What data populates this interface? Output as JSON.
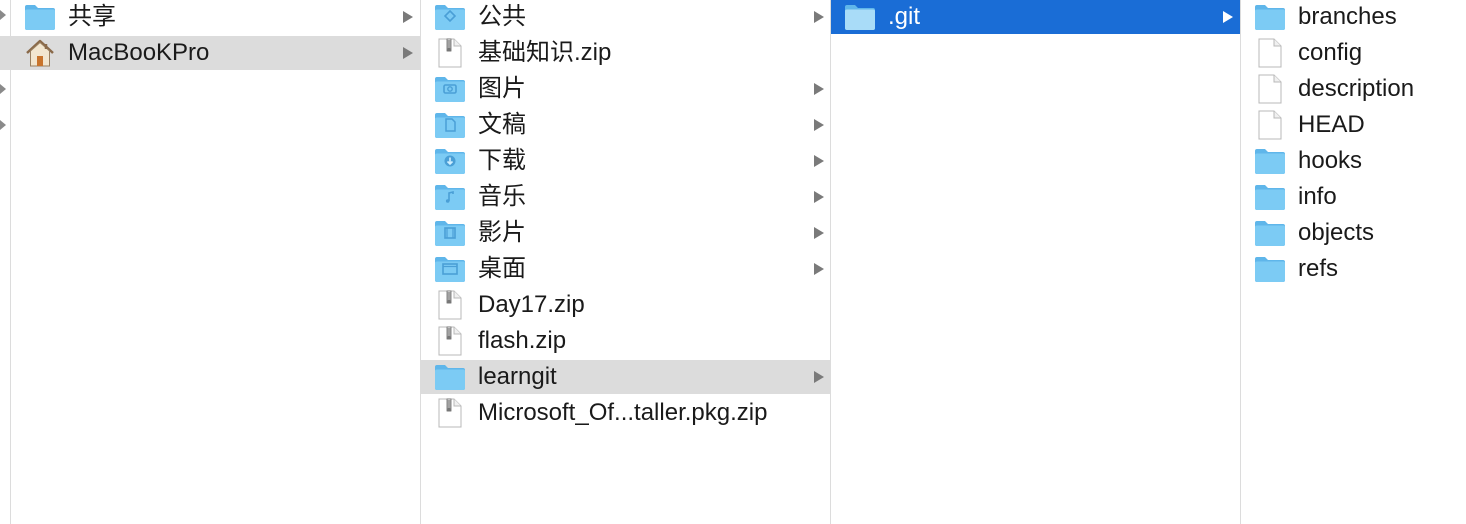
{
  "column1": {
    "items": [
      {
        "label": "共享",
        "icon": "folder-icon",
        "has_children": true
      },
      {
        "label": "MacBooKPro",
        "icon": "home-icon",
        "has_children": true,
        "selected": true
      }
    ]
  },
  "column2": {
    "items": [
      {
        "label": "公共",
        "icon": "public-folder-icon",
        "has_children": true
      },
      {
        "label": "基础知识.zip",
        "icon": "zip-file-icon",
        "has_children": false
      },
      {
        "label": "图片",
        "icon": "pictures-folder-icon",
        "has_children": true
      },
      {
        "label": "文稿",
        "icon": "documents-folder-icon",
        "has_children": true
      },
      {
        "label": "下载",
        "icon": "downloads-folder-icon",
        "has_children": true
      },
      {
        "label": "音乐",
        "icon": "music-folder-icon",
        "has_children": true
      },
      {
        "label": "影片",
        "icon": "movies-folder-icon",
        "has_children": true
      },
      {
        "label": "桌面",
        "icon": "desktop-folder-icon",
        "has_children": true
      },
      {
        "label": "Day17.zip",
        "icon": "zip-file-icon",
        "has_children": false
      },
      {
        "label": "flash.zip",
        "icon": "zip-file-icon",
        "has_children": false
      },
      {
        "label": "learngit",
        "icon": "folder-icon",
        "has_children": true,
        "selected": true
      },
      {
        "label": "Microsoft_Of...taller.pkg.zip",
        "icon": "zip-file-icon",
        "has_children": false
      }
    ]
  },
  "column3": {
    "items": [
      {
        "label": ".git",
        "icon": "folder-icon",
        "has_children": true,
        "selected": true
      }
    ]
  },
  "column4": {
    "items": [
      {
        "label": "branches",
        "icon": "folder-icon"
      },
      {
        "label": "config",
        "icon": "file-icon"
      },
      {
        "label": "description",
        "icon": "file-icon"
      },
      {
        "label": "HEAD",
        "icon": "file-icon"
      },
      {
        "label": "hooks",
        "icon": "folder-icon"
      },
      {
        "label": "info",
        "icon": "folder-icon"
      },
      {
        "label": "objects",
        "icon": "folder-icon"
      },
      {
        "label": "refs",
        "icon": "folder-icon"
      }
    ]
  },
  "colors": {
    "selection_blue": "#1a6dd6",
    "selection_gray": "#dcdcdc",
    "folder_blue": "#7ccbf4"
  }
}
